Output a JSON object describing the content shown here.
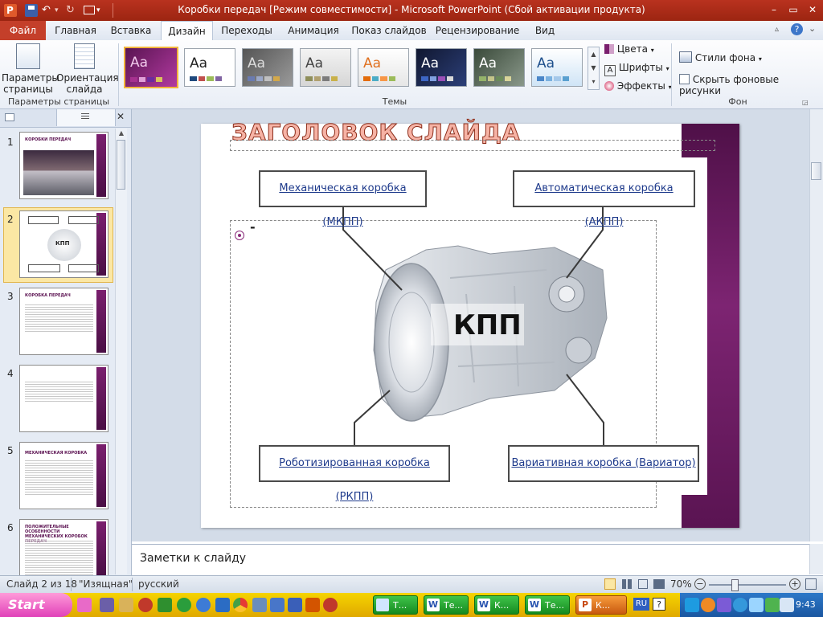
{
  "window": {
    "title": "Коробки передач [Режим совместимости]  -  Microsoft PowerPoint (Сбой активации продукта)"
  },
  "ribbon": {
    "tabs": [
      "Файл",
      "Главная",
      "Вставка",
      "Дизайн",
      "Переходы",
      "Анимация",
      "Показ слайдов",
      "Рецензирование",
      "Вид"
    ],
    "active_tab": "Дизайн",
    "page_setup": {
      "params_label": "Параметры страницы",
      "orientation_label": "Ориентация слайда",
      "group_label": "Параметры страницы"
    },
    "themes": {
      "group_label": "Темы",
      "colors_label": "Цвета",
      "fonts_label": "Шрифты",
      "effects_label": "Эффекты",
      "swatch_text": "Aa"
    },
    "background": {
      "group_label": "Фон",
      "styles_label": "Стили фона",
      "hide_graphics_label": "Скрыть фоновые рисунки"
    }
  },
  "slides_panel": {
    "thumbnails": [
      {
        "num": "1",
        "title": "КОРОБКИ ПЕРЕДАЧ"
      },
      {
        "num": "2",
        "title": ""
      },
      {
        "num": "3",
        "title": "КОРОБКА ПЕРЕДАЧ"
      },
      {
        "num": "4",
        "title": ""
      },
      {
        "num": "5",
        "title": "МЕХАНИЧЕСКАЯ КОРОБКА"
      },
      {
        "num": "6",
        "title": "ПОЛОЖИТЕЛЬНЫЕ ОСОБЕННОСТИ МЕХАНИЧЕСКИХ КОРОБОК ПЕРЕДАЧ"
      }
    ],
    "selected": "2"
  },
  "slide": {
    "title_placeholder": "ЗАГОЛОВОК СЛАЙДА",
    "bullet_dash": "-",
    "center_label": "КПП",
    "callouts": {
      "top_left": "Механическая коробка (МКПП)",
      "top_right": "Автоматическая коробка (АКПП)",
      "bottom_left": "Роботизированная коробка (РКПП)",
      "bottom_right": "Вариативная коробка (Вариатор)"
    }
  },
  "notes": {
    "placeholder": "Заметки к слайду"
  },
  "status": {
    "slide_info": "Слайд 2 из 18",
    "theme_name": "\"Изящная\"",
    "language": "русский",
    "zoom": "70%"
  },
  "taskbar": {
    "start_label": "Start",
    "buttons": [
      "Т...",
      "Те...",
      "К...",
      "Те...",
      "К..."
    ],
    "lang": "RU",
    "clock": "9:43"
  },
  "colors": {
    "accent_purple": "#7d2472",
    "title_bar": "#b9321f",
    "file_tab": "#c43f2a",
    "link_blue": "#1f3b8c"
  }
}
